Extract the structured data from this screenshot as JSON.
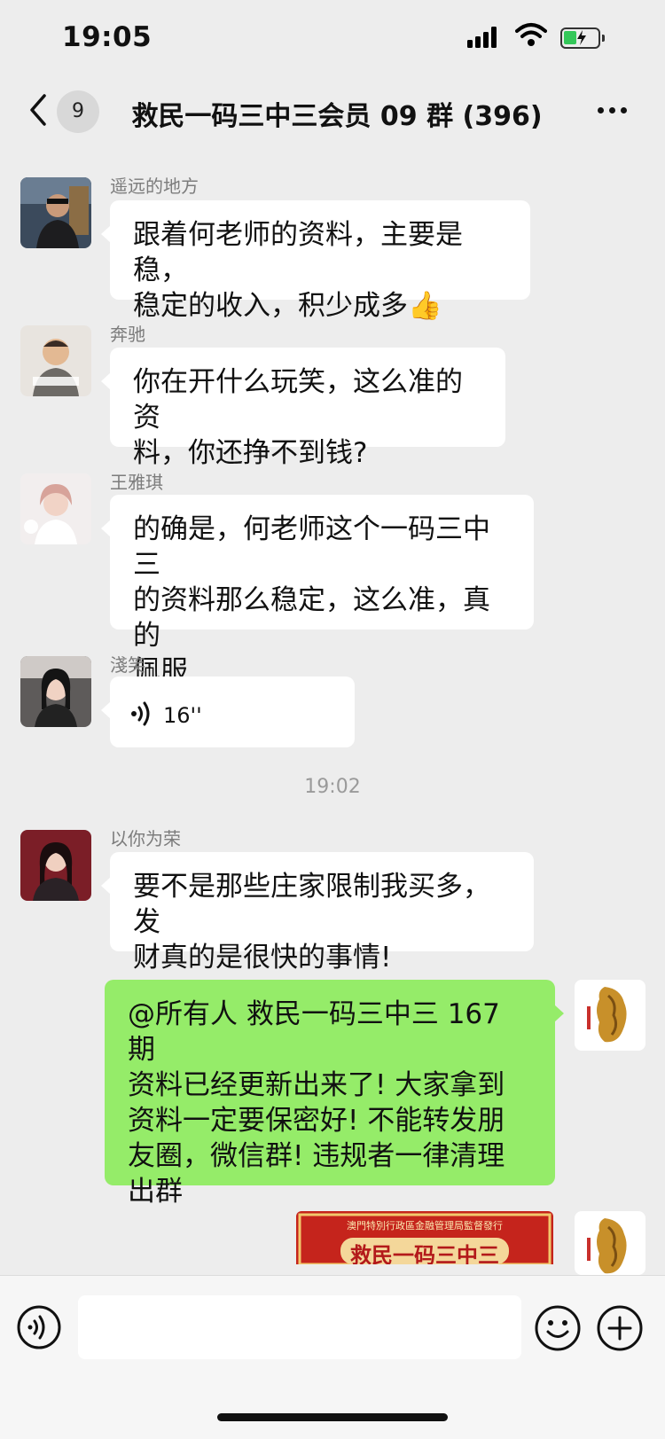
{
  "status_bar": {
    "time": "19:05",
    "battery_percent": 40
  },
  "nav": {
    "unread_count": "9",
    "title": "救民一码三中三会员 09 群 (396)"
  },
  "messages": [
    {
      "sender": "遥远的地方",
      "text_lines": [
        "跟着何老师的资料，主要是稳，",
        "稳定的收入，积少成多👍"
      ]
    },
    {
      "sender": "奔驰",
      "text_lines": [
        "你在开什么玩笑，这么准的资",
        "料，你还挣不到钱?"
      ]
    },
    {
      "sender": "王雅琪",
      "text_lines": [
        "的确是，何老师这个一码三中三",
        "的资料那么稳定，这么准，真的",
        "佩服"
      ]
    },
    {
      "sender": "淺笑",
      "voice_duration": "16''"
    },
    {
      "timestamp": "19:02"
    },
    {
      "sender": "以你为荣",
      "text_lines": [
        "要不是那些庄家限制我买多，发",
        "财真的是很快的事情!"
      ]
    },
    {
      "own": true,
      "text_lines": [
        "@所有人  救民一码三中三 167 期",
        "资料已经更新出来了! 大家拿到",
        "资料一定要保密好! 不能转发朋",
        "友圈，微信群! 违规者一律清理",
        "出群"
      ]
    }
  ],
  "poster": {
    "header": "澳門特別行政區金融管理局監督發行",
    "title": "救民一码三中三"
  },
  "colors": {
    "background": "#ededed",
    "own_bubble": "#95ec69",
    "other_bubble": "#ffffff",
    "input_bar": "#f6f6f6"
  },
  "icons": [
    "back-chevron-icon",
    "more-icon",
    "voice-wave-icon",
    "emoji-icon",
    "plus-icon",
    "signal-icon",
    "wifi-icon",
    "battery-icon"
  ]
}
